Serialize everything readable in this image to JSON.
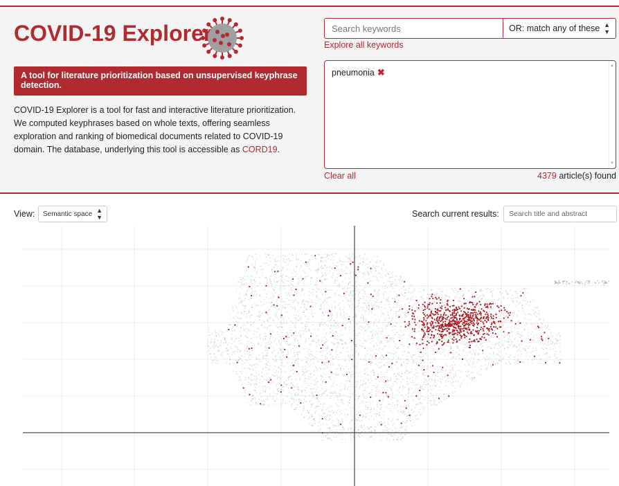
{
  "header": {
    "title": "COVID-19 Explorer",
    "logo_icon": "coronavirus-icon",
    "tagline": "A tool for literature prioritization based on unsupervised keyphrase detection.",
    "description_text": "COVID-19 Explorer is a tool for fast and interactive literature prioritization. We computed keyphrases based on whole texts, offering seamless exploration and ranking of biomedical documents related to COVID-19 domain. The database, underlying this tool is accessible as ",
    "description_link": "CORD19",
    "description_end": "."
  },
  "keyword_search": {
    "placeholder": "Search keywords",
    "mode_selected": "OR: match any of these",
    "explore_link": "Explore all keywords",
    "selected_keywords": [
      {
        "label": "pneumonia",
        "remove_icon": "close-icon"
      }
    ],
    "clear_all": "Clear all",
    "article_count": "4379",
    "article_suffix": " article(s) found"
  },
  "toolbar": {
    "view_label": "View:",
    "view_selected": "Semantic space",
    "search_results_label": "Search current results:",
    "search_results_placeholder": "Search title and abstract"
  },
  "colors": {
    "accent": "#b02a30",
    "highlight_point": "#a81d25",
    "background_point": "#555555",
    "header_bg": "#f4f4f4"
  },
  "plot": {
    "type": "scatter",
    "description": "semantic space embedding of articles; matching articles highlighted"
  }
}
